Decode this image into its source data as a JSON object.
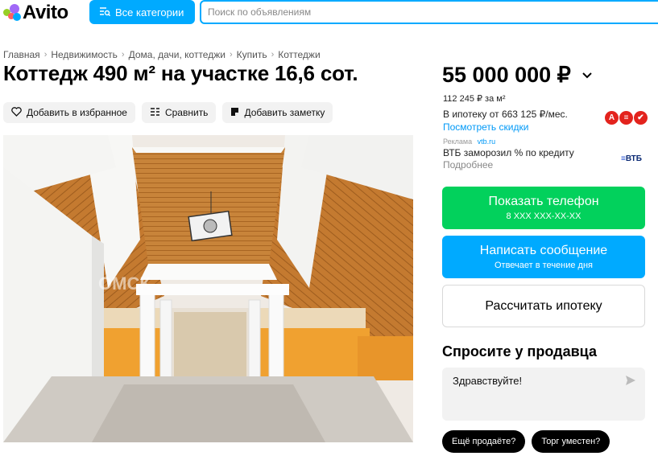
{
  "header": {
    "logo_text": "Avito",
    "categories_label": "Все категории",
    "search_placeholder": "Поиск по объявлениям"
  },
  "breadcrumb": [
    "Главная",
    "Недвижимость",
    "Дома, дачи, коттеджи",
    "Купить",
    "Коттеджи"
  ],
  "listing": {
    "title": "Коттедж 490 м² на участке 16,6 сот.",
    "actions": {
      "favorite": "Добавить в избранное",
      "compare": "Сравнить",
      "note": "Добавить заметку"
    },
    "photo_watermark": "ОМСК"
  },
  "sidebar": {
    "price": "55 000 000 ₽",
    "price_per_m": "112 245 ₽ за м²",
    "mortgage_text": "В ипотеку от 663 125 ₽/мес.",
    "discounts_link": "Посмотреть скидки",
    "ad": {
      "label": "Реклама",
      "domain": "vtb.ru",
      "text": "ВТБ заморозил % по кредиту",
      "more": "Подробнее",
      "brand": "ВТБ"
    },
    "phone_button": {
      "label": "Показать телефон",
      "sub": "8 XXX XXX-XX-XX"
    },
    "message_button": {
      "label": "Написать сообщение",
      "sub": "Отвечает в течение дня"
    },
    "mortgage_button": "Рассчитать ипотеку",
    "ask": {
      "title": "Спросите у продавца",
      "message": "Здравствуйте!",
      "chips": [
        "Ещё продаёте?",
        "Торг уместен?"
      ]
    }
  },
  "colors": {
    "brand_blue": "#00aaff",
    "green": "#02d15c",
    "link": "#0099f7"
  }
}
